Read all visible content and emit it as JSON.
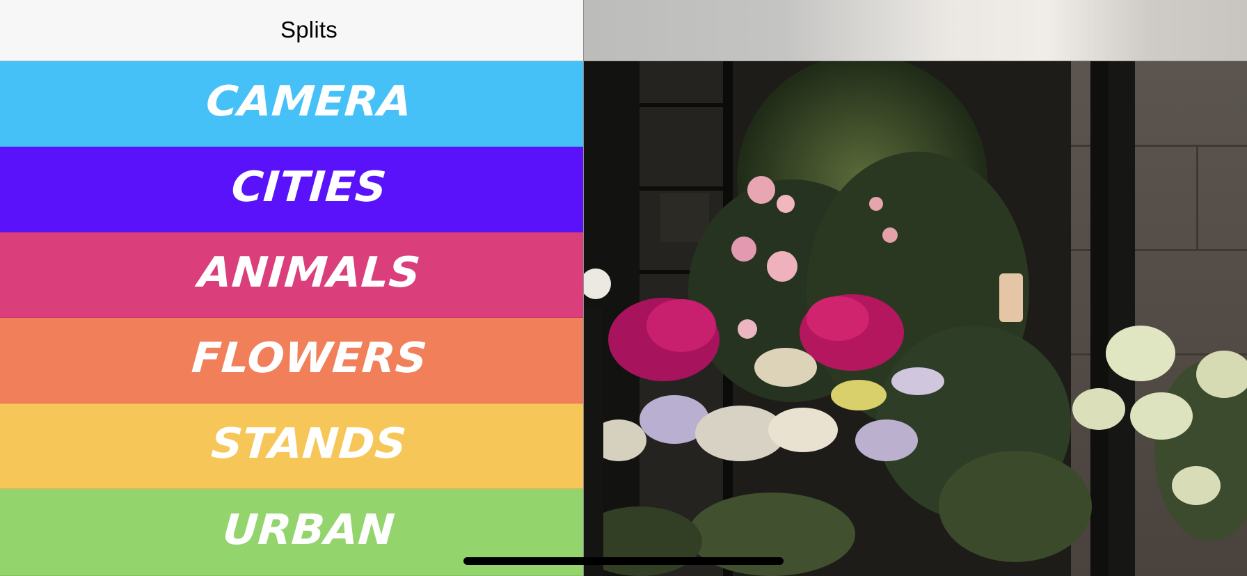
{
  "master": {
    "nav_title": "Splits"
  },
  "categories": [
    {
      "label": "CAMERA",
      "color": "#45c1f7"
    },
    {
      "label": "CITIES",
      "color": "#5a12fb"
    },
    {
      "label": "ANIMALS",
      "color": "#da3f7c"
    },
    {
      "label": "FLOWERS",
      "color": "#f07f5a"
    },
    {
      "label": "STANDS",
      "color": "#f7c659"
    },
    {
      "label": "URBAN",
      "color": "#94d46d"
    }
  ],
  "detail": {
    "image_subject": "flower-shop-storefront-photo"
  }
}
